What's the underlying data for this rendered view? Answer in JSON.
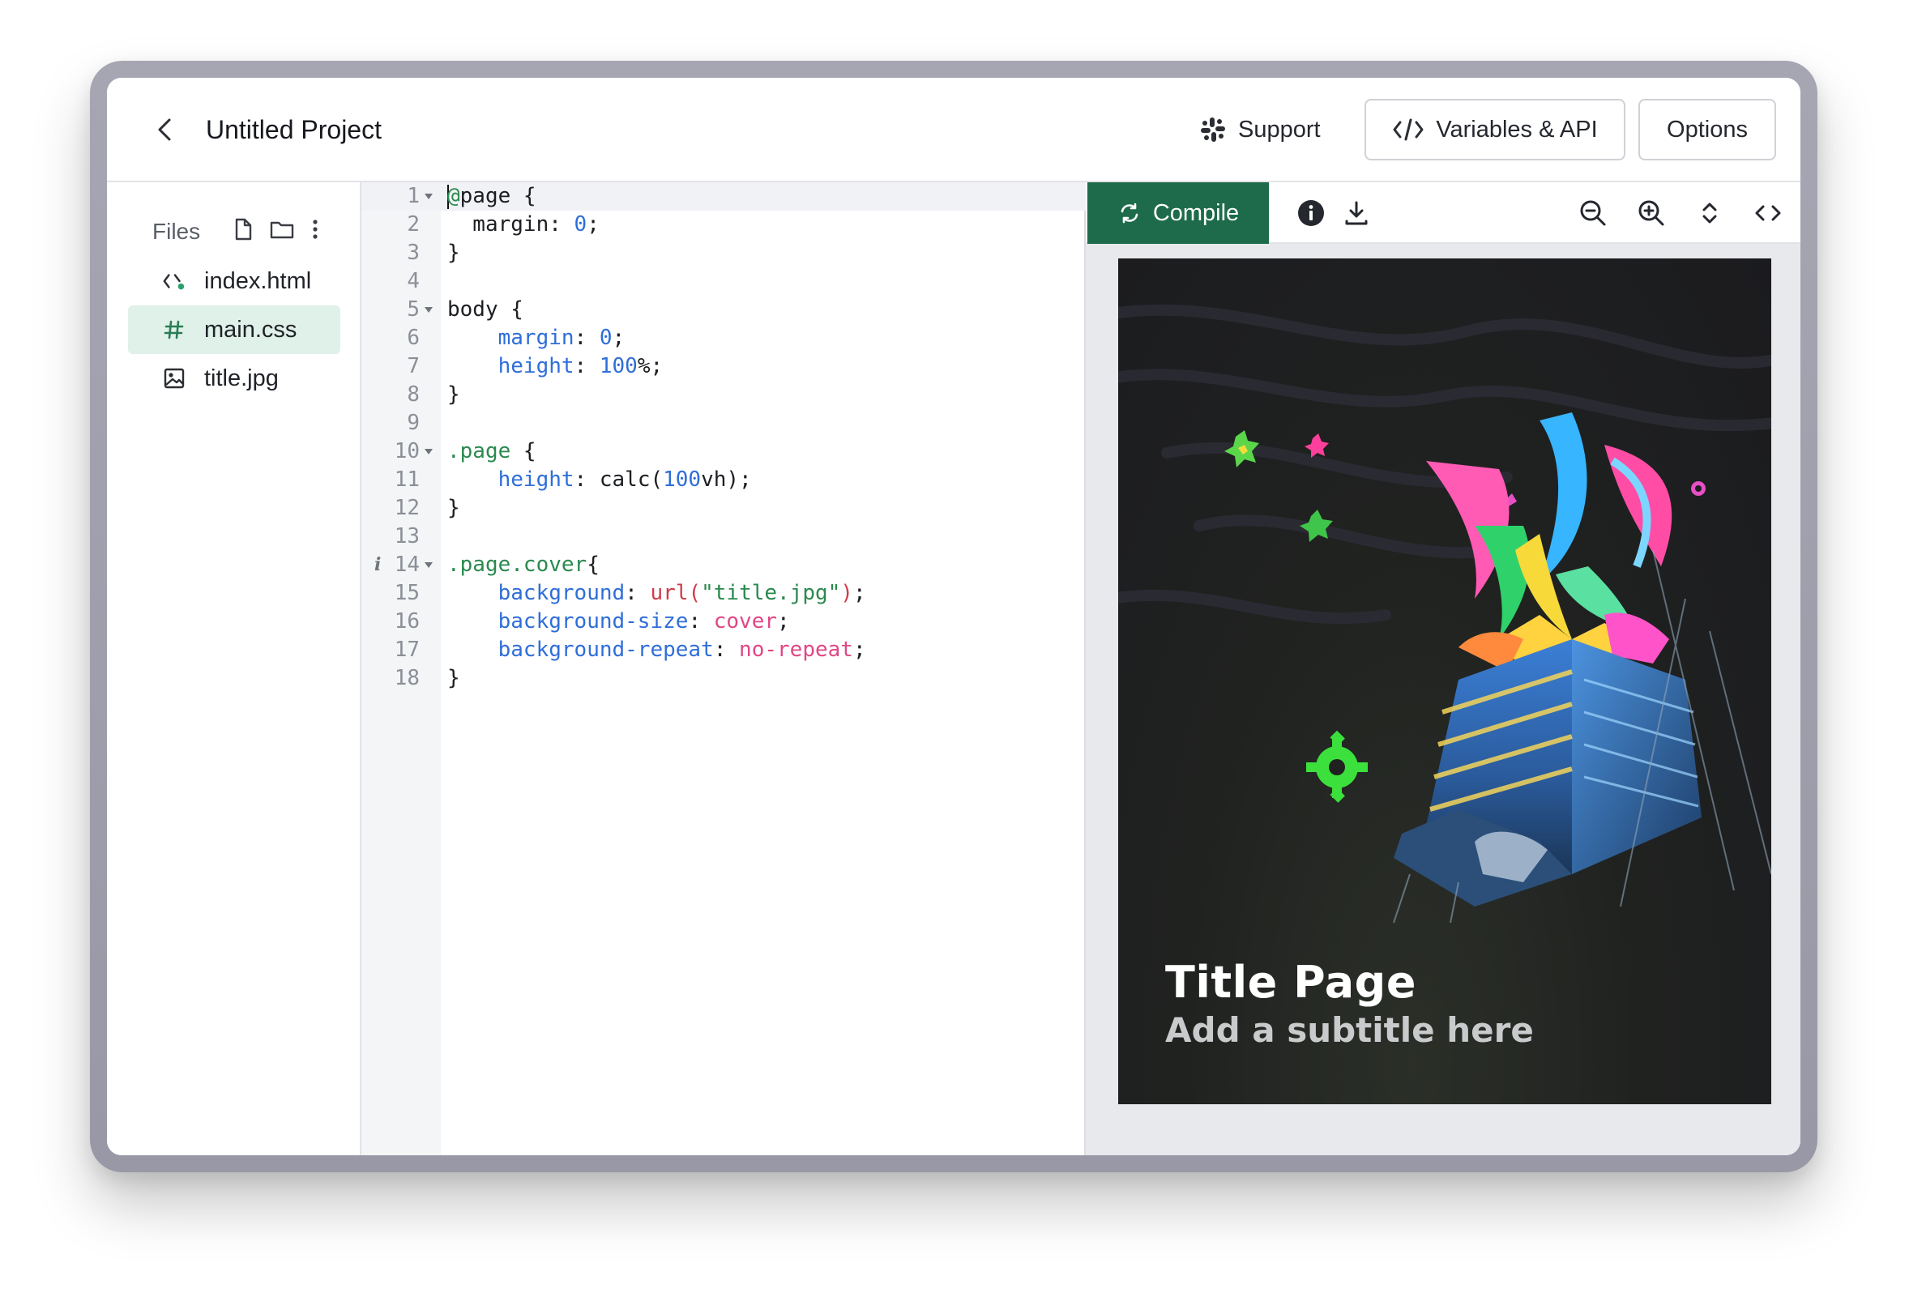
{
  "header": {
    "project_title": "Untitled Project",
    "support_label": "Support",
    "variables_label": "Variables & API",
    "options_label": "Options"
  },
  "sidebar": {
    "files_label": "Files",
    "files": [
      {
        "name": "index.html",
        "icon": "code-icon",
        "active": false
      },
      {
        "name": "main.css",
        "icon": "hash-icon",
        "active": true
      },
      {
        "name": "title.jpg",
        "icon": "image-icon",
        "active": false
      }
    ]
  },
  "editor": {
    "lines": [
      {
        "n": "1"
      },
      {
        "n": "2"
      },
      {
        "n": "3"
      },
      {
        "n": "4"
      },
      {
        "n": "5"
      },
      {
        "n": "6"
      },
      {
        "n": "7"
      },
      {
        "n": "8"
      },
      {
        "n": "9"
      },
      {
        "n": "10"
      },
      {
        "n": "11"
      },
      {
        "n": "12"
      },
      {
        "n": "13"
      },
      {
        "n": "14"
      },
      {
        "n": "15"
      },
      {
        "n": "16"
      },
      {
        "n": "17"
      },
      {
        "n": "18"
      }
    ]
  },
  "preview": {
    "compile_label": "Compile",
    "cover_title": "Title Page",
    "cover_subtitle": "Add a subtitle here"
  },
  "colors": {
    "accent": "#1d6b4a",
    "active_file_bg": "#dff1e8",
    "css_property": "#2f6ed8",
    "css_selector": "#2a8a4e",
    "css_value": "#e04785",
    "css_function": "#d13b4a"
  }
}
